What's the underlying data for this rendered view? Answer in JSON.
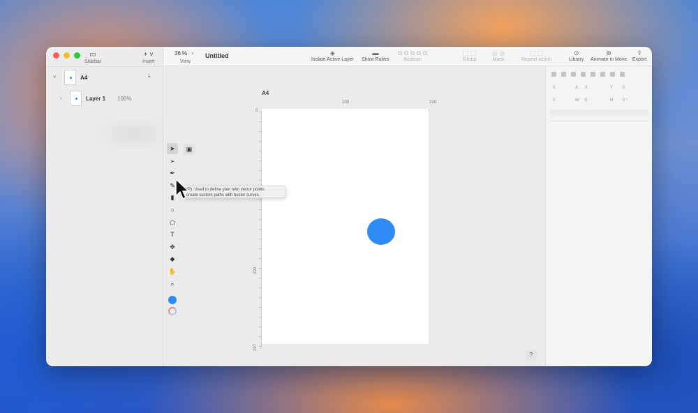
{
  "sidebar": {
    "tools": [
      {
        "label": "Sidebar",
        "icon": "sidebar-icon"
      },
      {
        "label": "Insert",
        "icon": "plus-icon"
      }
    ],
    "layers": [
      {
        "name": "A4",
        "type": "artboard"
      },
      {
        "name": "Layer 1",
        "opacity": "100%"
      }
    ]
  },
  "toolbar": {
    "zoom_value": "36 %",
    "zoom_label": "View",
    "doc_title": "Untitled",
    "items": [
      {
        "label": "Isolate Active Layer",
        "enabled": true
      },
      {
        "label": "Show Rulers",
        "enabled": true
      },
      {
        "label": "Boolean",
        "enabled": false
      },
      {
        "label": "Group",
        "enabled": false
      },
      {
        "label": "Mask",
        "enabled": false
      },
      {
        "label": "Repeat action",
        "enabled": false
      },
      {
        "label": "Library",
        "enabled": true
      },
      {
        "label": "Animate in Move",
        "enabled": true
      },
      {
        "label": "Export",
        "enabled": true
      }
    ]
  },
  "canvas": {
    "artboard_label": "A4",
    "ruler_top": [
      "0",
      "100",
      "210"
    ],
    "ruler_left": [
      "0",
      "200",
      "297"
    ],
    "shape": {
      "type": "circle",
      "color": "#2f8cf5"
    }
  },
  "tooltip": {
    "line1": "(P). Used to define your own vector points",
    "line2": "create custom paths with bezier curves."
  },
  "inspector": {
    "x_label": "X",
    "y_label": "Y",
    "w_label": "W",
    "h_label": "H",
    "x_value": "0",
    "y_value": "0",
    "w_value": "0",
    "h_value": "0",
    "rotation": "0 °"
  },
  "help_label": "?",
  "colors": {
    "accent": "#2f8cf5",
    "fill": "#2f8cf5"
  }
}
